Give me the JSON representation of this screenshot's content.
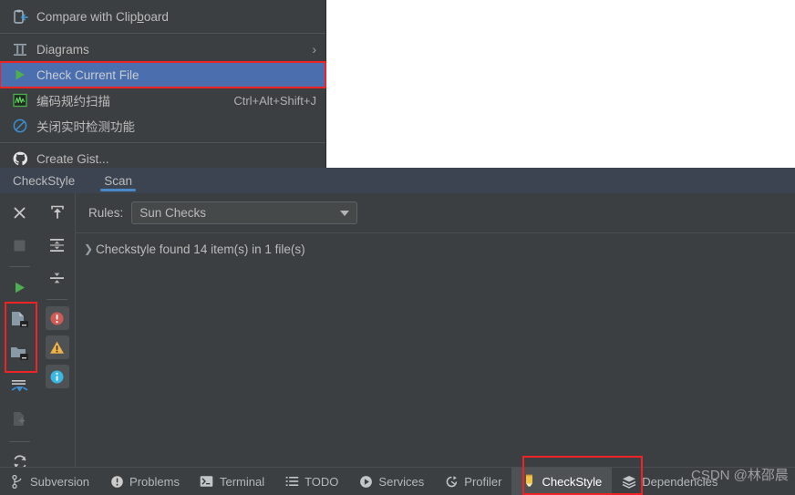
{
  "context_menu": {
    "items": [
      {
        "id": "compare-with-clipboard",
        "label": "Compare with Clipboard",
        "mnemonic": "b",
        "icon": "clipboard-compare-icon",
        "shortcut": "",
        "submenu": false,
        "selected": false
      },
      {
        "id": "diagrams",
        "label": "Diagrams",
        "icon": "diagrams-icon",
        "shortcut": "",
        "submenu": true,
        "selected": false
      },
      {
        "id": "check-current-file",
        "label": "Check Current File",
        "icon": "green-play-icon",
        "shortcut": "",
        "submenu": false,
        "selected": true
      },
      {
        "id": "coding-convention-scan",
        "label": "编码规约扫描",
        "icon": "alibaba-scan-icon",
        "shortcut": "Ctrl+Alt+Shift+J",
        "submenu": false,
        "selected": false
      },
      {
        "id": "disable-realtime-detection",
        "label": "关闭实时检测功能",
        "icon": "disable-circle-icon",
        "shortcut": "",
        "submenu": false,
        "selected": false
      },
      {
        "id": "create-gist",
        "label": "Create Gist...",
        "icon": "github-icon",
        "shortcut": "",
        "submenu": false,
        "selected": false
      }
    ],
    "separators_after": [
      "compare-with-clipboard",
      "disable-realtime-detection"
    ]
  },
  "toolwindow": {
    "tabs": [
      {
        "id": "checkstyle",
        "label": "CheckStyle",
        "active": false
      },
      {
        "id": "scan",
        "label": "Scan",
        "active": true
      }
    ],
    "rules": {
      "label": "Rules:",
      "selected": "Sun Checks",
      "options": [
        "Sun Checks"
      ]
    },
    "tree": {
      "root_label": "Checkstyle found 14 item(s) in 1 file(s)",
      "expanded": false,
      "found_count": 14,
      "file_count": 1
    },
    "rail_primary": [
      {
        "id": "close",
        "name": "close-icon",
        "enabled": true
      },
      {
        "id": "stop",
        "name": "stop-icon",
        "enabled": false
      },
      {
        "id": "run",
        "name": "run-play-icon",
        "enabled": true
      },
      {
        "id": "scan-current-file",
        "name": "scan-current-file-icon",
        "enabled": true
      },
      {
        "id": "scan-module",
        "name": "scan-module-icon",
        "enabled": true
      },
      {
        "id": "scan-project",
        "name": "scan-project-icon",
        "enabled": true
      },
      {
        "id": "scan-changed-files",
        "name": "scan-changed-files-icon",
        "enabled": false
      },
      {
        "id": "refresh",
        "name": "refresh-icon",
        "enabled": true
      }
    ],
    "rail_secondary": [
      {
        "id": "scroll-export",
        "name": "export-up-icon",
        "enabled": true
      },
      {
        "id": "expand-all",
        "name": "expand-all-icon",
        "enabled": true
      },
      {
        "id": "collapse-all",
        "name": "collapse-all-icon",
        "enabled": true
      }
    ],
    "severity_filters": [
      {
        "id": "errors",
        "name": "error-severity-icon",
        "color": "#cf5b56",
        "active": true
      },
      {
        "id": "warnings",
        "name": "warning-severity-icon",
        "color": "#edb24a",
        "active": true
      },
      {
        "id": "infos",
        "name": "info-severity-icon",
        "color": "#3ab6e3",
        "active": true
      }
    ]
  },
  "statusbar": {
    "items": [
      {
        "id": "subversion",
        "label": "Subversion",
        "icon": "branch-icon",
        "active": false
      },
      {
        "id": "problems",
        "label": "Problems",
        "icon": "problems-icon",
        "active": false
      },
      {
        "id": "terminal",
        "label": "Terminal",
        "icon": "terminal-icon",
        "active": false
      },
      {
        "id": "todo",
        "label": "TODO",
        "icon": "todo-list-icon",
        "active": false
      },
      {
        "id": "services",
        "label": "Services",
        "icon": "services-play-icon",
        "active": false
      },
      {
        "id": "profiler",
        "label": "Profiler",
        "icon": "profiler-icon",
        "active": false
      },
      {
        "id": "checkstyle",
        "label": "CheckStyle",
        "icon": "checkstyle-pencil-icon",
        "active": true
      },
      {
        "id": "dependencies",
        "label": "Dependencies",
        "icon": "layers-icon",
        "active": false
      }
    ]
  },
  "watermark": {
    "text": "CSDN @林邵晨"
  },
  "highlights": {
    "accent_blue": "#4b6eaf",
    "annotation_red": "#ef2323",
    "selection_tab_underline": "#4a88c7"
  }
}
